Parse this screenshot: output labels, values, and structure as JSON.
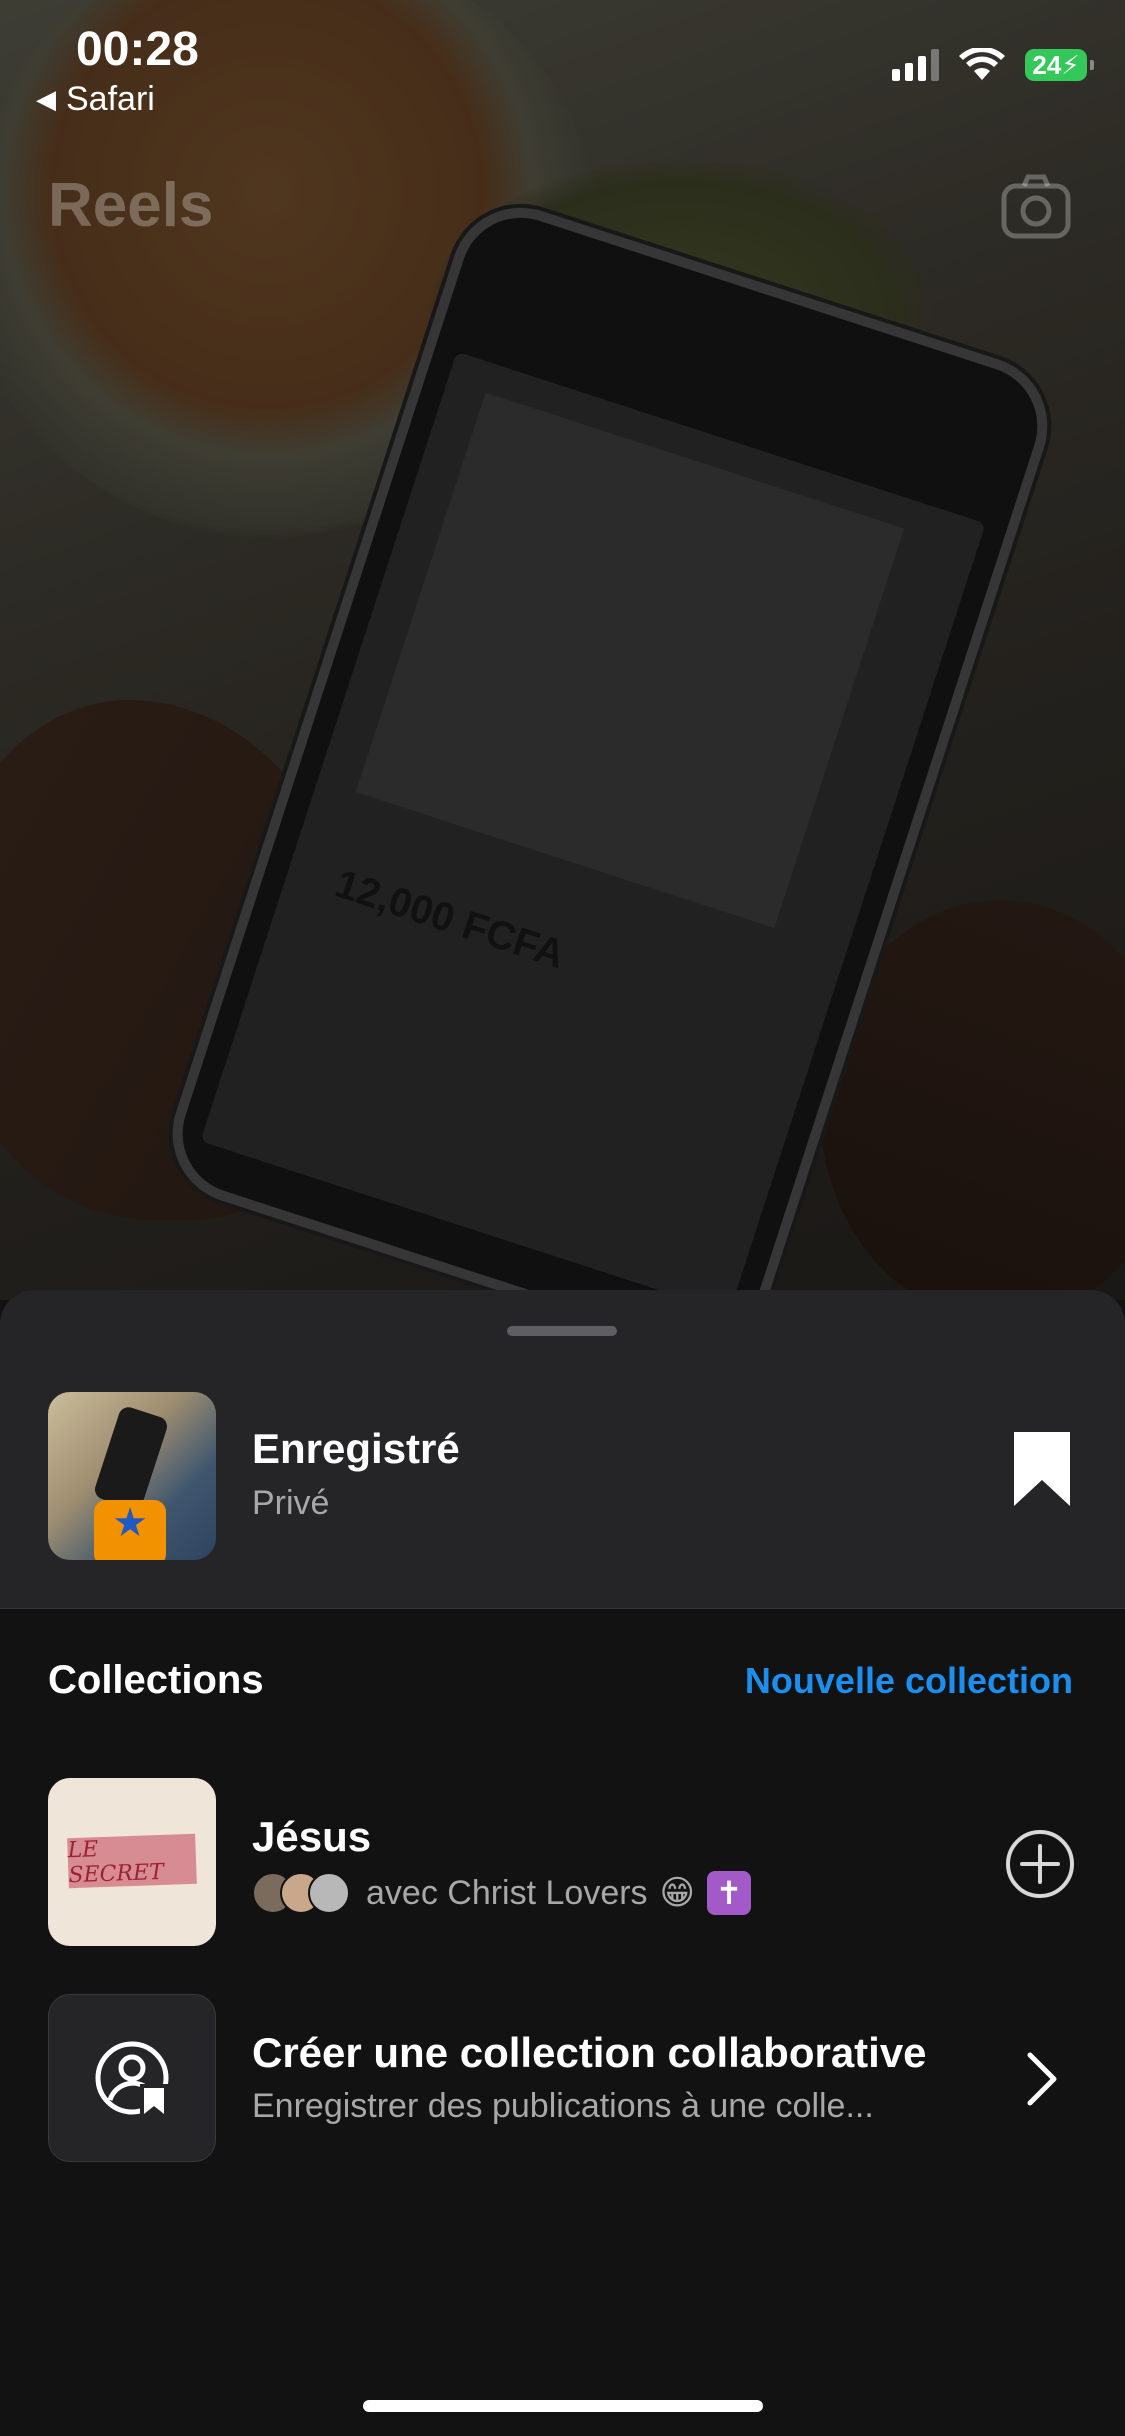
{
  "status_bar": {
    "time": "00:28",
    "back_app": "Safari",
    "battery": "24"
  },
  "header": {
    "title": "Reels",
    "camera_icon": "camera-icon"
  },
  "background_reel": {
    "phone_price": "12,000 FCFA"
  },
  "saved": {
    "title": "Enregistré",
    "subtitle": "Privé",
    "icon": "bookmark-icon"
  },
  "collections": {
    "label": "Collections",
    "new_label": "Nouvelle collection",
    "items": [
      {
        "title": "Jésus",
        "subtitle": "avec Christ Lovers",
        "emoji": "😁",
        "cross": "✝",
        "thumb_text": "LE SECRET",
        "action_icon": "plus-circle-icon"
      },
      {
        "title": "Créer une collection collaborative",
        "subtitle": "Enregistrer des publications à une colle...",
        "action_icon": "chevron-right-icon"
      }
    ]
  },
  "colors": {
    "accent": "#1a8fef",
    "sheet_top": "#252527",
    "sheet_body": "#121212",
    "battery": "#34c759"
  }
}
